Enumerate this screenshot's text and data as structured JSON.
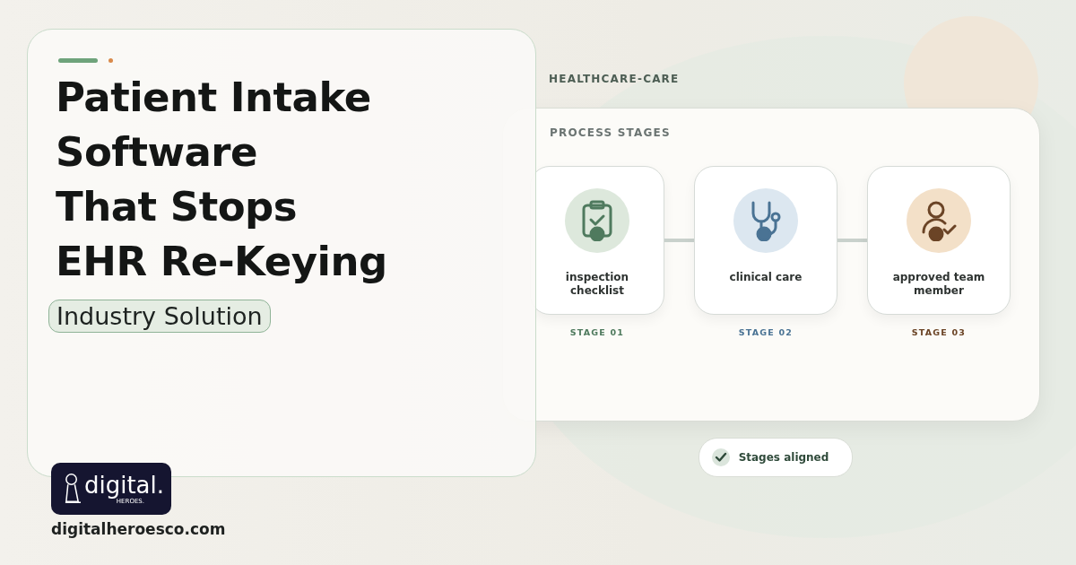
{
  "hero": {
    "title_lines": [
      "Patient Intake",
      "Software",
      "That Stops",
      "EHR Re-Keying"
    ],
    "tag": "Industry Solution"
  },
  "brand": {
    "logo_word": "digital.",
    "logo_sub": "HEROES.",
    "website": "digitalheroesco.com"
  },
  "panel": {
    "eyebrow": "HEALTHCARE-CARE",
    "heading": "PROCESS STAGES",
    "stages": [
      {
        "kind": "clipboard",
        "label": "inspection checklist",
        "stage": "STAGE 01",
        "color": "#4f7a5e"
      },
      {
        "kind": "stethoscope",
        "label": "clinical care",
        "stage": "STAGE 02",
        "color": "#4a7394"
      },
      {
        "kind": "user-check",
        "label": "approved team member",
        "stage": "STAGE 03",
        "color": "#6b4426"
      }
    ]
  },
  "status": {
    "label": "Stages aligned",
    "checked": true
  }
}
